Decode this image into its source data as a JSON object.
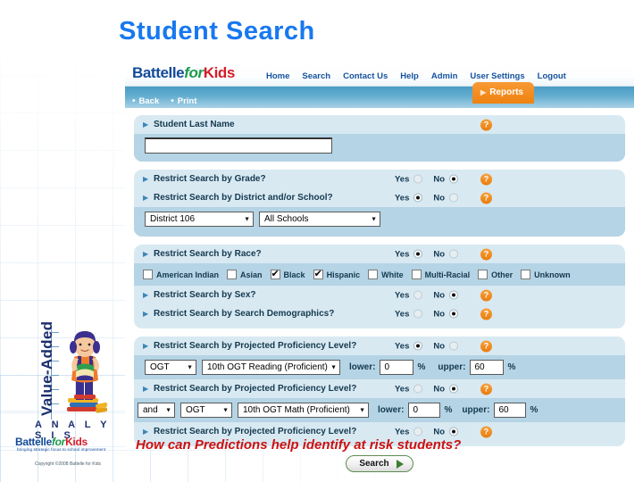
{
  "slide": {
    "title": "Student Search",
    "caption": "How can Predictions help identify at risk students?"
  },
  "brand": {
    "logo_part1": "Battelle",
    "logo_part2": "for",
    "logo_part3": "Kids",
    "tagline": "bringing strategic focus to school improvement",
    "copyright": "Copyright ©2008  Battelle for Kids",
    "va_title": "Value-Added",
    "va_subtitle": "A N A L Y S I S"
  },
  "nav": {
    "items": [
      {
        "label": "Home"
      },
      {
        "label": "Search"
      },
      {
        "label": "Contact Us"
      },
      {
        "label": "Help"
      },
      {
        "label": "Admin"
      },
      {
        "label": "User Settings"
      },
      {
        "label": "Logout"
      }
    ],
    "subbar": [
      {
        "label": "Back"
      },
      {
        "label": "Print"
      }
    ],
    "reports_tab": "Reports"
  },
  "form": {
    "help_glyph": "?",
    "yes_label": "Yes",
    "no_label": "No",
    "student_last_name": {
      "label": "Student Last Name",
      "value": "",
      "placeholder": ""
    },
    "grade": {
      "label": "Restrict Search by Grade?",
      "selected": "No"
    },
    "district_school": {
      "label": "Restrict Search by District and/or School?",
      "selected": "Yes",
      "district_value": "District 106",
      "school_value": "All Schools"
    },
    "race": {
      "label": "Restrict Search by Race?",
      "selected": "Yes",
      "options": [
        {
          "label": "American Indian",
          "checked": false
        },
        {
          "label": "Asian",
          "checked": false
        },
        {
          "label": "Black",
          "checked": true
        },
        {
          "label": "Hispanic",
          "checked": true
        },
        {
          "label": "White",
          "checked": false
        },
        {
          "label": "Multi-Racial",
          "checked": false
        },
        {
          "label": "Other",
          "checked": false
        },
        {
          "label": "Unknown",
          "checked": false
        }
      ]
    },
    "sex": {
      "label": "Restrict Search by Sex?",
      "selected": "No"
    },
    "demographics": {
      "label": "Restrict Search by Search Demographics?",
      "selected": "No"
    },
    "proficiency_1": {
      "label": "Restrict Search by Projected Proficiency Level?",
      "selected": "Yes",
      "test_value": "OGT",
      "subject_value": "10th OGT Reading (Proficient)",
      "lower_label": "lower:",
      "lower_value": "0",
      "upper_label": "upper:",
      "upper_value": "60",
      "percent": "%"
    },
    "proficiency_2": {
      "label": "Restrict Search by Projected Proficiency Level?",
      "selected": "No",
      "conjunction_value": "and",
      "test_value": "OGT",
      "subject_value": "10th OGT Math (Proficient)",
      "lower_label": "lower:",
      "lower_value": "0",
      "upper_label": "upper:",
      "upper_value": "60",
      "percent": "%"
    },
    "proficiency_3": {
      "label": "Restrict Search by Projected Proficiency Level?",
      "selected": "No"
    },
    "search_button": "Search"
  }
}
